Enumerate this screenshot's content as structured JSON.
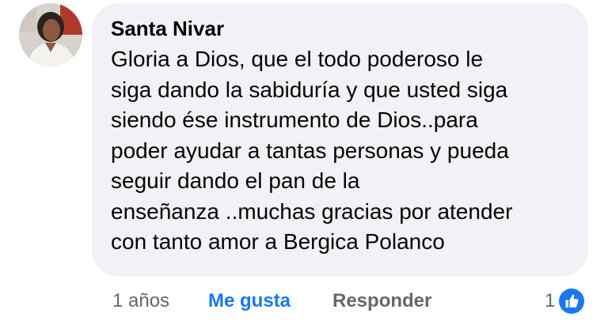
{
  "comment": {
    "author": "Santa Nivar",
    "text_lines": [
      "Gloria a Dios, que el todo poderoso le",
      "siga dando la sabiduría y que usted siga",
      "siendo ése instrumento de Dios..para",
      "poder ayudar a tantas personas y pueda",
      "seguir dando el pan de la",
      "enseñanza ..muchas gracias por atender",
      "con tanto amor a Bergica Polanco"
    ],
    "timestamp": "1 años",
    "like_label": "Me gusta",
    "reply_label": "Responder",
    "reaction_count": "1",
    "reaction_icon": "thumbs-up-icon"
  },
  "colors": {
    "bubble_bg": "#f0f2f5",
    "link_blue": "#1877f2",
    "meta_gray": "#65676b",
    "text": "#050505"
  }
}
